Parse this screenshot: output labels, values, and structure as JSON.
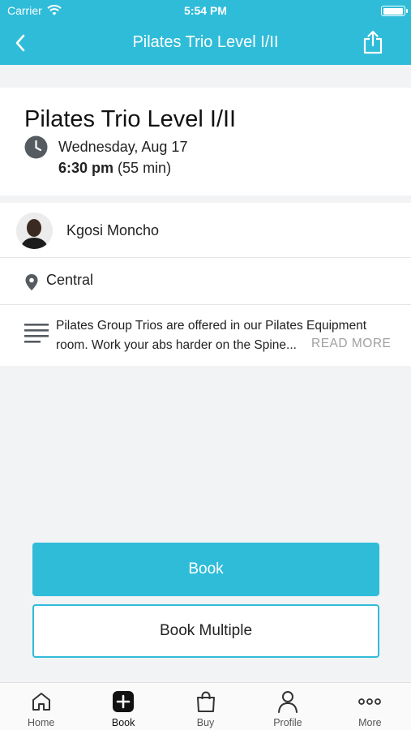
{
  "status_bar": {
    "carrier": "Carrier",
    "time": "5:54 PM"
  },
  "nav": {
    "title": "Pilates Trio Level I/II",
    "back_icon": "chevron-left-icon",
    "share_icon": "share-icon"
  },
  "class": {
    "title": "Pilates Trio Level I/II",
    "date": "Wednesday, Aug 17",
    "time": "6:30 pm",
    "duration": "(55 min)"
  },
  "instructor": {
    "name": "Kgosi Moncho"
  },
  "location": {
    "name": "Central"
  },
  "description": {
    "text": "Pilates Group Trios are offered in our Pilates Equipment room. Work your abs harder on the Spine...",
    "read_more": "READ MORE"
  },
  "actions": {
    "book": "Book",
    "book_multiple": "Book Multiple"
  },
  "tabs": [
    {
      "label": "Home",
      "icon": "home-icon"
    },
    {
      "label": "Book",
      "icon": "plus-square-icon",
      "active": true
    },
    {
      "label": "Buy",
      "icon": "shopping-bag-icon"
    },
    {
      "label": "Profile",
      "icon": "person-icon"
    },
    {
      "label": "More",
      "icon": "ellipsis-icon"
    }
  ],
  "colors": {
    "accent": "#2fbcd9",
    "background": "#f2f3f5"
  }
}
